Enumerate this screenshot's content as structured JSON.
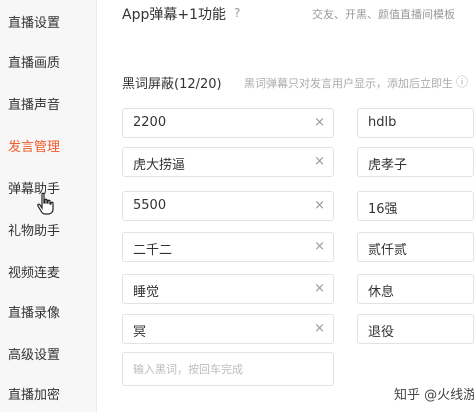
{
  "sidebar": {
    "items": [
      {
        "label": "直播设置"
      },
      {
        "label": "直播画质"
      },
      {
        "label": "直播声音"
      },
      {
        "label": "发言管理"
      },
      {
        "label": "弹幕助手"
      },
      {
        "label": "礼物助手"
      },
      {
        "label": "视频连麦"
      },
      {
        "label": "直播录像"
      },
      {
        "label": "高级设置"
      },
      {
        "label": "直播加密"
      }
    ],
    "active_color": "#f05a28"
  },
  "app_bullet": {
    "title": "App弹幕+1功能",
    "help_icon": "?",
    "desc": "交友、开黑、颜值直播间模板"
  },
  "blocklist": {
    "title": "黑词屏蔽(12/20)",
    "desc": "黑词弹幕只对发言用户显示，添加后立即生",
    "col_left": [
      "2200",
      "虎大捞逼",
      "5500",
      "二千二",
      "睡觉",
      "冥"
    ],
    "col_right": [
      "hdlb",
      "虎孝子",
      "16强",
      "贰仟贰",
      "休息",
      "退役"
    ],
    "remove_icon": "×",
    "input_placeholder": "输入黑词，按回车完成"
  },
  "watermark": "知乎 @火线游戏"
}
